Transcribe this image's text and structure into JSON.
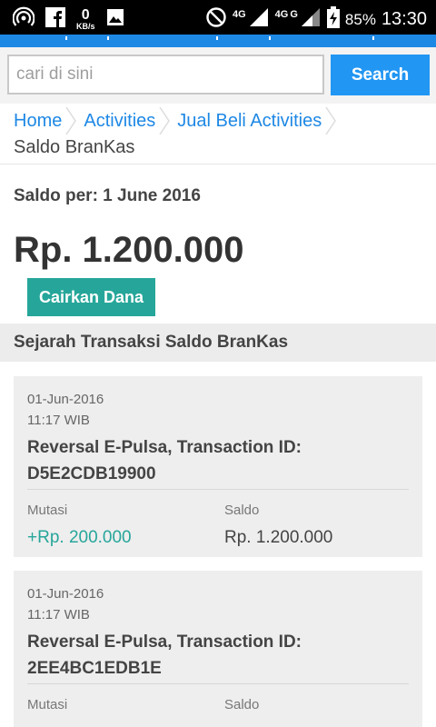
{
  "status_bar": {
    "net_speed": "0",
    "net_unit": "KB/s",
    "network_1": "4G",
    "network_2": "4G",
    "network_3": "G",
    "battery": "85%",
    "time": "13:30",
    "icons": [
      "wifi-hotspot-icon",
      "facebook-icon",
      "image-icon",
      "do-not-disturb-icon",
      "signal-icon",
      "battery-charging-icon"
    ]
  },
  "search": {
    "placeholder": "cari di sini",
    "button_label": "Search"
  },
  "breadcrumb": {
    "items": [
      "Home",
      "Activities",
      "Jual Beli Activities"
    ],
    "current": "Saldo BranKas"
  },
  "balance": {
    "date_label": "Saldo per: 1 June 2016",
    "amount": "Rp. 1.200.000",
    "withdraw_label": "Cairkan Dana"
  },
  "history": {
    "title": "Sejarah Transaksi Saldo BranKas",
    "mutasi_label": "Mutasi",
    "saldo_label": "Saldo",
    "transactions": [
      {
        "date": "01-Jun-2016",
        "time": "11:17 WIB",
        "title": "Reversal E-Pulsa, Transaction ID: D5E2CDB19900",
        "mutasi": "+Rp. 200.000",
        "saldo": "Rp. 1.200.000"
      },
      {
        "date": "01-Jun-2016",
        "time": "11:17 WIB",
        "title": "Reversal E-Pulsa, Transaction ID: 2EE4BC1EDB1E",
        "mutasi": "",
        "saldo": ""
      }
    ]
  },
  "colors": {
    "accent": "#2196F3",
    "link": "#1E88E5",
    "teal": "#26A69A"
  }
}
